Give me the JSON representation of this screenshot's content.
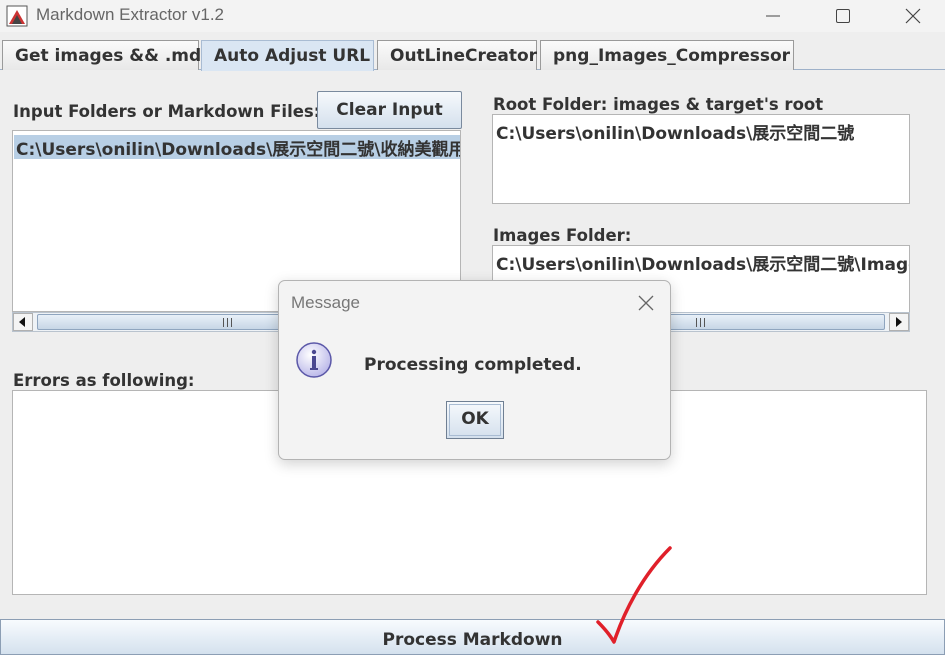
{
  "window": {
    "title": "Markdown Extractor v1.2"
  },
  "tabs": [
    {
      "label": "Get images && .md"
    },
    {
      "label": "Auto Adjust URL"
    },
    {
      "label": "OutLineCreator"
    },
    {
      "label": "png_Images_Compressor"
    }
  ],
  "active_tab": "Auto Adjust URL",
  "left_panel": {
    "input_label": "Input Folders or Markdown Files:",
    "clear_button": "Clear Input",
    "input_items": [
      "C:\\Users\\onilin\\Downloads\\展示空間二號\\收納美觀用"
    ],
    "errors_label": "Errors as following:",
    "errors_text": ""
  },
  "right_panel": {
    "root_label": "Root Folder: images & target's root",
    "root_value": "C:\\Users\\onilin\\Downloads\\展示空間二號",
    "images_label": "Images Folder:",
    "images_value": "C:\\Users\\onilin\\Downloads\\展示空間二號\\Images"
  },
  "dialog": {
    "title": "Message",
    "message": "Processing completed.",
    "ok_button": "OK",
    "icon": "info-icon"
  },
  "process_button": "Process Markdown",
  "annotation": "red-checkmark",
  "colors": {
    "tab_active": "#dae6f3",
    "selection": "#b8cfe5",
    "button_gradient_bottom": "#d4e0ed",
    "checkmark": "#e0202a"
  }
}
